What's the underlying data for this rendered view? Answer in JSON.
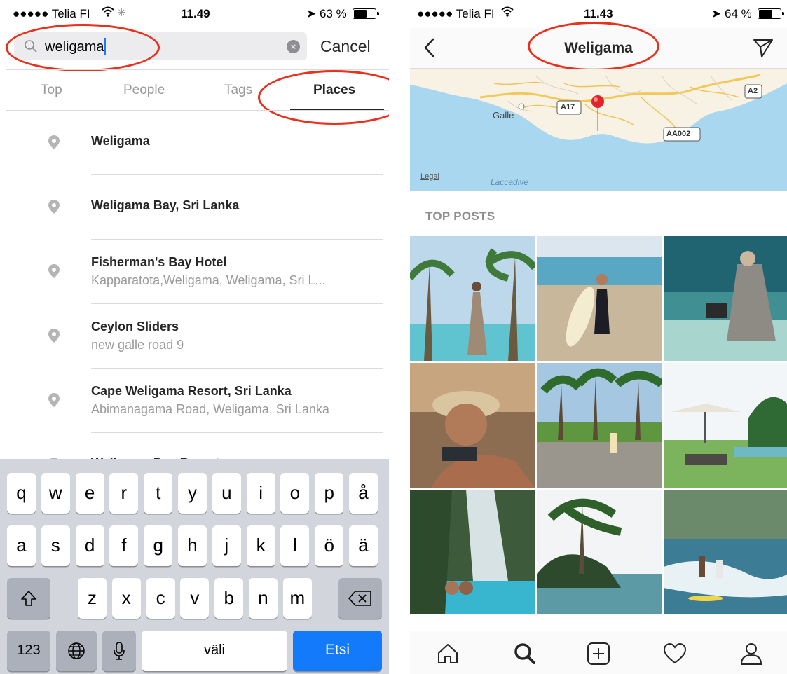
{
  "left_screen": {
    "status": {
      "carrier": "●●●●● Telia FI",
      "time": "11.49",
      "battery": "63 %"
    },
    "search": {
      "query": "weligama",
      "cancel_label": "Cancel"
    },
    "tabs": [
      {
        "label": "Top"
      },
      {
        "label": "People"
      },
      {
        "label": "Tags"
      },
      {
        "label": "Places"
      }
    ],
    "active_tab": "Places",
    "results": [
      {
        "name": "Weligama",
        "address": ""
      },
      {
        "name": "Weligama Bay, Sri Lanka",
        "address": ""
      },
      {
        "name": "Fisherman's Bay Hotel",
        "address": "Kapparatota,Weligama, Weligama, Sri L..."
      },
      {
        "name": "Ceylon Sliders",
        "address": "new galle road 9"
      },
      {
        "name": "Cape Weligama Resort, Sri Lanka",
        "address": "Abimanagama Road, Weligama, Sri Lanka"
      },
      {
        "name": "Weligama Bay Resort",
        "address": ""
      }
    ],
    "keyboard": {
      "row1": [
        "q",
        "w",
        "e",
        "r",
        "t",
        "y",
        "u",
        "i",
        "o",
        "p",
        "å"
      ],
      "row2": [
        "a",
        "s",
        "d",
        "f",
        "g",
        "h",
        "j",
        "k",
        "l",
        "ö",
        "ä"
      ],
      "row3": [
        "z",
        "x",
        "c",
        "v",
        "b",
        "n",
        "m"
      ],
      "numbers_key": "123",
      "space_key": "väli",
      "search_key": "Etsi"
    }
  },
  "right_screen": {
    "status": {
      "carrier": "●●●●● Telia FI",
      "time": "11.43",
      "battery": "64 %"
    },
    "header": {
      "title": "Weligama"
    },
    "map": {
      "labels": {
        "city": "Galle",
        "road_a17": "A17",
        "road_a2": "A2",
        "road_aa002": "AA002",
        "legal": "Legal",
        "sea": "Laccadive"
      }
    },
    "section_label": "TOP POSTS",
    "photos": [
      {
        "subject": "woman-palms-pool"
      },
      {
        "subject": "surfer-beach"
      },
      {
        "subject": "woman-sitting-floor"
      },
      {
        "subject": "woman-hat-closeup"
      },
      {
        "subject": "surfer-palms-road"
      },
      {
        "subject": "resort-pool-umbrellas"
      },
      {
        "subject": "waterfall-lagoon"
      },
      {
        "subject": "island-palms"
      },
      {
        "subject": "surfers-waves"
      }
    ],
    "tabbar": [
      "home-icon",
      "search-icon",
      "add-post-icon",
      "heart-icon",
      "profile-icon"
    ]
  },
  "colors": {
    "highlight": "#e8301c",
    "ios_blue": "#137afc",
    "pin_red": "#e0242a"
  }
}
